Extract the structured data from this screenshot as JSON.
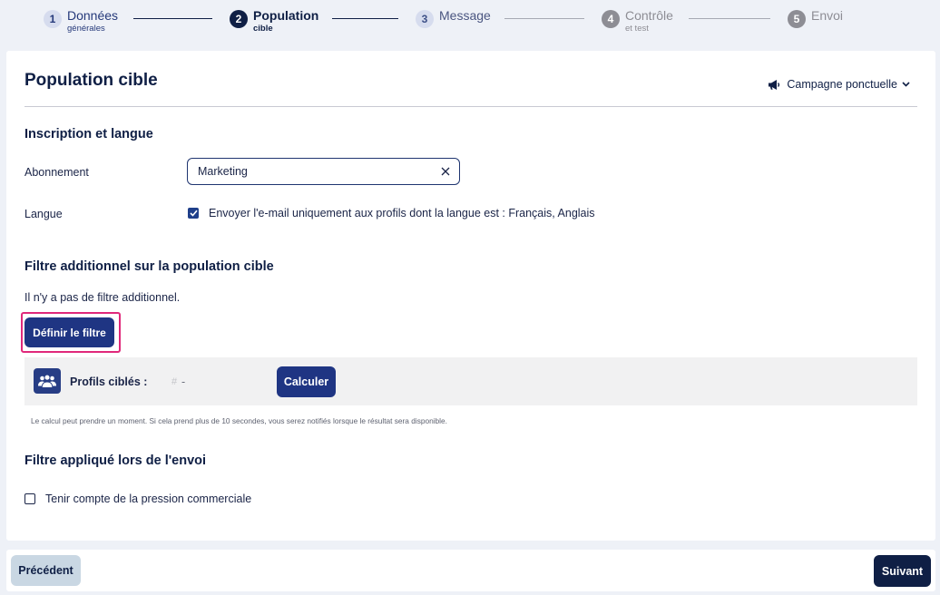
{
  "stepper": {
    "steps": [
      {
        "num": "1",
        "main": "Données",
        "sub": "générales"
      },
      {
        "num": "2",
        "main": "Population",
        "sub": "cible"
      },
      {
        "num": "3",
        "main": "Message",
        "sub": ""
      },
      {
        "num": "4",
        "main": "Contrôle",
        "sub": "et test"
      },
      {
        "num": "5",
        "main": "Envoi",
        "sub": ""
      }
    ],
    "active_index": 1
  },
  "header": {
    "title": "Population cible",
    "campaign_type": "Campagne ponctuelle"
  },
  "inscription": {
    "title": "Inscription et langue",
    "subscription_label": "Abonnement",
    "subscription_value": "Marketing",
    "language_label": "Langue",
    "language_checkbox_label": "Envoyer l'e-mail uniquement aux profils dont la langue est : Français, Anglais",
    "language_checked": true
  },
  "filter": {
    "title": "Filtre additionnel sur la population cible",
    "empty_text": "Il n'y a pas de filtre additionnel.",
    "define_button": "Définir le filtre",
    "profiles_label": "Profils ciblés :",
    "profiles_hash": "#",
    "profiles_value": "-",
    "calculate_button": "Calculer",
    "note": "Le calcul peut prendre un moment. Si cela prend plus de 10 secondes, vous serez notifiés lorsque le résultat sera disponible."
  },
  "send_filter": {
    "title": "Filtre appliqué lors de l'envoi",
    "pressure_checkbox_label": "Tenir compte de la pression commerciale",
    "pressure_checked": false
  },
  "footer": {
    "prev_label": "Précédent",
    "next_label": "Suivant"
  }
}
